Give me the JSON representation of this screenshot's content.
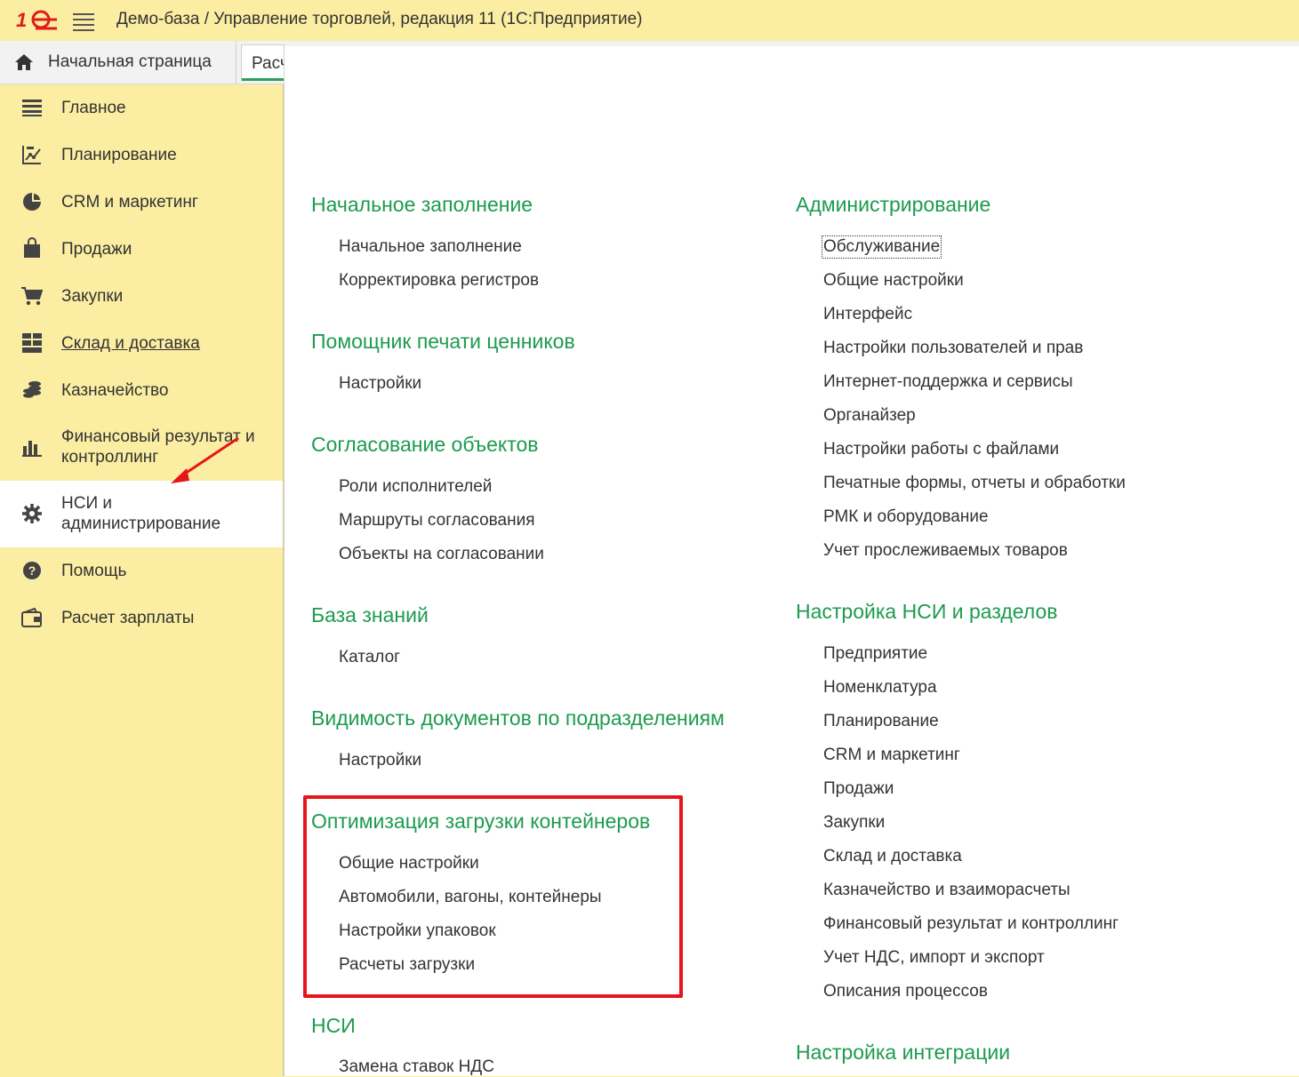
{
  "titlebar": {
    "logo_text": "1С",
    "title": "Демо-база / Управление торговлей, редакция 11  (1С:Предприятие)"
  },
  "tabs": {
    "home": "Начальная страница",
    "calc": "Расчет зарплаты"
  },
  "sidebar": {
    "items": [
      {
        "label": "Главное",
        "icon": "menu-lines-icon"
      },
      {
        "label": "Планирование",
        "icon": "planning-chart-icon"
      },
      {
        "label": "CRM и маркетинг",
        "icon": "pie-chart-icon"
      },
      {
        "label": "Продажи",
        "icon": "shopping-bag-icon"
      },
      {
        "label": "Закупки",
        "icon": "cart-icon"
      },
      {
        "label": "Склад и доставка",
        "icon": "warehouse-grid-icon"
      },
      {
        "label": "Казначейство",
        "icon": "coins-icon"
      },
      {
        "label": "Финансовый результат и контроллинг",
        "icon": "bar-chart-icon"
      },
      {
        "label": "НСИ и администрирование",
        "icon": "gear-icon"
      },
      {
        "label": "Помощь",
        "icon": "help-icon"
      },
      {
        "label": "Расчет зарплаты",
        "icon": "wallet-icon"
      }
    ],
    "active_index": 8
  },
  "left_column": [
    {
      "title": "Начальное заполнение",
      "links": [
        "Начальное заполнение",
        "Корректировка регистров"
      ]
    },
    {
      "title": "Помощник печати ценников",
      "links": [
        "Настройки"
      ]
    },
    {
      "title": "Согласование объектов",
      "links": [
        "Роли исполнителей",
        "Маршруты согласования",
        "Объекты на согласовании"
      ]
    },
    {
      "title": "База знаний",
      "links": [
        "Каталог"
      ]
    },
    {
      "title": "Видимость документов по подразделениям",
      "links": [
        "Настройки"
      ]
    },
    {
      "title": "Оптимизация загрузки контейнеров",
      "links": [
        "Общие настройки",
        "Автомобили, вагоны, контейнеры",
        "Настройки упаковок",
        "Расчеты загрузки"
      ]
    },
    {
      "title": "НСИ",
      "links": [
        "Замена ставок НДС"
      ]
    }
  ],
  "right_column": [
    {
      "title": "Администрирование",
      "links": [
        "Обслуживание",
        "Общие настройки",
        "Интерфейс",
        "Настройки пользователей и прав",
        "Интернет-поддержка и сервисы",
        "Органайзер",
        "Настройки работы с файлами",
        "Печатные формы, отчеты и обработки",
        "РМК и оборудование",
        "Учет прослеживаемых товаров"
      ]
    },
    {
      "title": "Настройка НСИ и разделов",
      "links": [
        "Предприятие",
        "Номенклатура",
        "Планирование",
        "CRM и маркетинг",
        "Продажи",
        "Закупки",
        "Склад и доставка",
        "Казначейство и взаиморасчеты",
        "Финансовый результат и контроллинг",
        "Учет НДС, импорт и экспорт",
        "Описания процессов"
      ]
    },
    {
      "title": "Настройка интеграции",
      "links": []
    }
  ],
  "colors": {
    "accent_green": "#1d9b4f",
    "sidebar_bg": "#fbeda1",
    "highlight_red": "#e8141b"
  }
}
